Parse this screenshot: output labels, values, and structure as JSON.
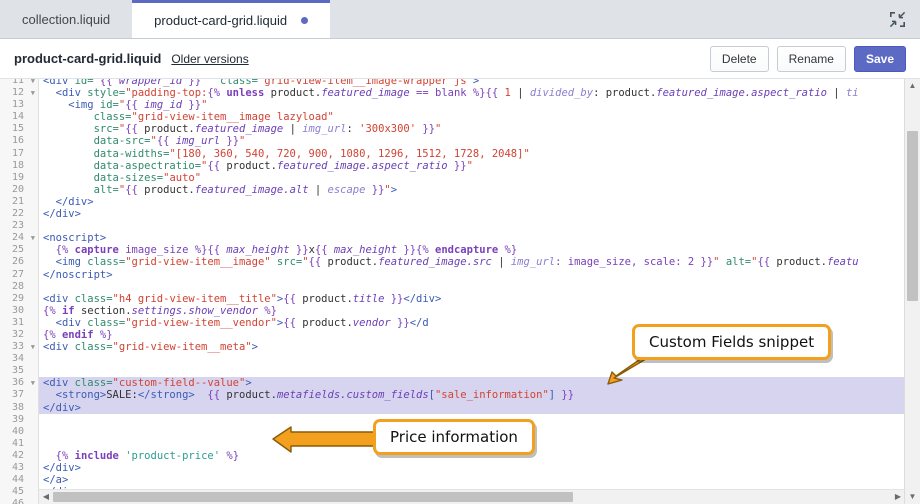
{
  "window": {
    "tabs": [
      {
        "label": "collection.liquid",
        "active": false,
        "modified": false
      },
      {
        "label": "product-card-grid.liquid",
        "active": true,
        "modified": true
      }
    ],
    "expand_icon": "collapse-arrows-icon"
  },
  "header": {
    "filename": "product-card-grid.liquid",
    "older_versions_label": "Older versions",
    "buttons": {
      "delete": "Delete",
      "rename": "Rename",
      "save": "Save"
    }
  },
  "colors": {
    "accent": "#5c6ac4",
    "callout_border": "#f2a01e",
    "highlight_row": "#d7d4f0",
    "tabbar_bg": "#dfe3e8"
  },
  "editor": {
    "first_line": 11,
    "last_line": 46,
    "highlighted_lines": [
      36,
      37,
      38
    ],
    "fold_markers": [
      11,
      12,
      24,
      33,
      36
    ],
    "lines": [
      {
        "n": 11,
        "tokens": [
          {
            "t": "<div ",
            "c": "t-tag"
          },
          {
            "t": "id=",
            "c": "t-attr"
          },
          {
            "t": "\"",
            "c": "t-str"
          },
          {
            "t": "{{ ",
            "c": "t-liq"
          },
          {
            "t": "wrapper_id",
            "c": "t-var"
          },
          {
            "t": " }}",
            "c": "t-liq"
          },
          {
            "t": "\"  ",
            "c": "t-str"
          },
          {
            "t": "class=",
            "c": "t-attr"
          },
          {
            "t": "\"grid-view-item__image-wrapper js\"",
            "c": "t-str"
          },
          {
            "t": ">",
            "c": "t-tag"
          }
        ]
      },
      {
        "n": 12,
        "tokens": [
          {
            "t": "  <div ",
            "c": "t-tag"
          },
          {
            "t": "style=",
            "c": "t-attr"
          },
          {
            "t": "\"padding-top:",
            "c": "t-str"
          },
          {
            "t": "{% ",
            "c": "t-liq"
          },
          {
            "t": "unless",
            "c": "t-kw"
          },
          {
            "t": " product.",
            "c": "t-plain"
          },
          {
            "t": "featured_image",
            "c": "t-var"
          },
          {
            "t": " == blank %}",
            "c": "t-liq"
          },
          {
            "t": "{{ ",
            "c": "t-liq"
          },
          {
            "t": "1",
            "c": "t-num"
          },
          {
            "t": " | ",
            "c": "t-plain"
          },
          {
            "t": "divided_by",
            "c": "t-flt"
          },
          {
            "t": ": product.",
            "c": "t-plain"
          },
          {
            "t": "featured_image.aspect_ratio",
            "c": "t-var"
          },
          {
            "t": " | ",
            "c": "t-plain"
          },
          {
            "t": "ti",
            "c": "t-flt"
          }
        ]
      },
      {
        "n": 13,
        "tokens": [
          {
            "t": "    <img ",
            "c": "t-tag"
          },
          {
            "t": "id=",
            "c": "t-attr"
          },
          {
            "t": "\"",
            "c": "t-str"
          },
          {
            "t": "{{ ",
            "c": "t-liq"
          },
          {
            "t": "img_id",
            "c": "t-var"
          },
          {
            "t": " }}",
            "c": "t-liq"
          },
          {
            "t": "\"",
            "c": "t-str"
          }
        ]
      },
      {
        "n": 14,
        "tokens": [
          {
            "t": "        ",
            "c": "t-plain"
          },
          {
            "t": "class=",
            "c": "t-attr"
          },
          {
            "t": "\"grid-view-item__image lazyload\"",
            "c": "t-str"
          }
        ]
      },
      {
        "n": 15,
        "tokens": [
          {
            "t": "        ",
            "c": "t-plain"
          },
          {
            "t": "src=",
            "c": "t-attr"
          },
          {
            "t": "\"",
            "c": "t-str"
          },
          {
            "t": "{{ ",
            "c": "t-liq"
          },
          {
            "t": "product.",
            "c": "t-plain"
          },
          {
            "t": "featured_image",
            "c": "t-var"
          },
          {
            "t": " | ",
            "c": "t-plain"
          },
          {
            "t": "img_url",
            "c": "t-flt"
          },
          {
            "t": ": ",
            "c": "t-plain"
          },
          {
            "t": "'300x300'",
            "c": "t-num"
          },
          {
            "t": " }}",
            "c": "t-liq"
          },
          {
            "t": "\"",
            "c": "t-str"
          }
        ]
      },
      {
        "n": 16,
        "tokens": [
          {
            "t": "        ",
            "c": "t-plain"
          },
          {
            "t": "data-src=",
            "c": "t-attr"
          },
          {
            "t": "\"",
            "c": "t-str"
          },
          {
            "t": "{{ ",
            "c": "t-liq"
          },
          {
            "t": "img_url",
            "c": "t-var"
          },
          {
            "t": " }}",
            "c": "t-liq"
          },
          {
            "t": "\"",
            "c": "t-str"
          }
        ]
      },
      {
        "n": 17,
        "tokens": [
          {
            "t": "        ",
            "c": "t-plain"
          },
          {
            "t": "data-widths=",
            "c": "t-attr"
          },
          {
            "t": "\"[180, 360, 540, 720, 900, 1080, 1296, 1512, 1728, 2048]\"",
            "c": "t-str"
          }
        ]
      },
      {
        "n": 18,
        "tokens": [
          {
            "t": "        ",
            "c": "t-plain"
          },
          {
            "t": "data-aspectratio=",
            "c": "t-attr"
          },
          {
            "t": "\"",
            "c": "t-str"
          },
          {
            "t": "{{ ",
            "c": "t-liq"
          },
          {
            "t": "product.",
            "c": "t-plain"
          },
          {
            "t": "featured_image.aspect_ratio",
            "c": "t-var"
          },
          {
            "t": " }}",
            "c": "t-liq"
          },
          {
            "t": "\"",
            "c": "t-str"
          }
        ]
      },
      {
        "n": 19,
        "tokens": [
          {
            "t": "        ",
            "c": "t-plain"
          },
          {
            "t": "data-sizes=",
            "c": "t-attr"
          },
          {
            "t": "\"auto\"",
            "c": "t-str"
          }
        ]
      },
      {
        "n": 20,
        "tokens": [
          {
            "t": "        ",
            "c": "t-plain"
          },
          {
            "t": "alt=",
            "c": "t-attr"
          },
          {
            "t": "\"",
            "c": "t-str"
          },
          {
            "t": "{{ ",
            "c": "t-liq"
          },
          {
            "t": "product.",
            "c": "t-plain"
          },
          {
            "t": "featured_image.alt",
            "c": "t-var"
          },
          {
            "t": " | ",
            "c": "t-plain"
          },
          {
            "t": "escape",
            "c": "t-flt"
          },
          {
            "t": " }}",
            "c": "t-liq"
          },
          {
            "t": "\"",
            "c": "t-str"
          },
          {
            "t": ">",
            "c": "t-tag"
          }
        ]
      },
      {
        "n": 21,
        "tokens": [
          {
            "t": "  </div>",
            "c": "t-tag"
          }
        ]
      },
      {
        "n": 22,
        "tokens": [
          {
            "t": "</div>",
            "c": "t-tag"
          }
        ]
      },
      {
        "n": 23,
        "tokens": []
      },
      {
        "n": 24,
        "tokens": [
          {
            "t": "<noscript>",
            "c": "t-tag"
          }
        ]
      },
      {
        "n": 25,
        "tokens": [
          {
            "t": "  ",
            "c": "t-plain"
          },
          {
            "t": "{% ",
            "c": "t-liq"
          },
          {
            "t": "capture",
            "c": "t-kw"
          },
          {
            "t": " image_size %}",
            "c": "t-liq"
          },
          {
            "t": "{{ ",
            "c": "t-liq"
          },
          {
            "t": "max_height",
            "c": "t-var"
          },
          {
            "t": " }}",
            "c": "t-liq"
          },
          {
            "t": "x",
            "c": "t-plain"
          },
          {
            "t": "{{ ",
            "c": "t-liq"
          },
          {
            "t": "max_height",
            "c": "t-var"
          },
          {
            "t": " }}",
            "c": "t-liq"
          },
          {
            "t": "{% ",
            "c": "t-liq"
          },
          {
            "t": "endcapture",
            "c": "t-kw"
          },
          {
            "t": " %}",
            "c": "t-liq"
          }
        ]
      },
      {
        "n": 26,
        "tokens": [
          {
            "t": "  <img ",
            "c": "t-tag"
          },
          {
            "t": "class=",
            "c": "t-attr"
          },
          {
            "t": "\"grid-view-item__image\"",
            "c": "t-str"
          },
          {
            "t": " src=",
            "c": "t-attr"
          },
          {
            "t": "\"",
            "c": "t-str"
          },
          {
            "t": "{{ ",
            "c": "t-liq"
          },
          {
            "t": "product.",
            "c": "t-plain"
          },
          {
            "t": "featured_image.src",
            "c": "t-var"
          },
          {
            "t": " | ",
            "c": "t-plain"
          },
          {
            "t": "img_url",
            "c": "t-flt"
          },
          {
            "t": ": image_size, scale: 2 }}",
            "c": "t-liq"
          },
          {
            "t": "\"",
            "c": "t-str"
          },
          {
            "t": " alt=",
            "c": "t-attr"
          },
          {
            "t": "\"",
            "c": "t-str"
          },
          {
            "t": "{{ ",
            "c": "t-liq"
          },
          {
            "t": "product.",
            "c": "t-plain"
          },
          {
            "t": "featu",
            "c": "t-var"
          }
        ]
      },
      {
        "n": 27,
        "tokens": [
          {
            "t": "</noscript>",
            "c": "t-tag"
          }
        ]
      },
      {
        "n": 28,
        "tokens": []
      },
      {
        "n": 29,
        "tokens": [
          {
            "t": "<div ",
            "c": "t-tag"
          },
          {
            "t": "class=",
            "c": "t-attr"
          },
          {
            "t": "\"h4 grid-view-item__title\"",
            "c": "t-str"
          },
          {
            "t": ">",
            "c": "t-tag"
          },
          {
            "t": "{{ ",
            "c": "t-liq"
          },
          {
            "t": "product.",
            "c": "t-plain"
          },
          {
            "t": "title",
            "c": "t-var"
          },
          {
            "t": " }}",
            "c": "t-liq"
          },
          {
            "t": "</div>",
            "c": "t-tag"
          }
        ]
      },
      {
        "n": 30,
        "tokens": [
          {
            "t": "{% ",
            "c": "t-liq"
          },
          {
            "t": "if",
            "c": "t-kw"
          },
          {
            "t": " section.",
            "c": "t-plain"
          },
          {
            "t": "settings.show_vendor",
            "c": "t-var"
          },
          {
            "t": " %}",
            "c": "t-liq"
          }
        ]
      },
      {
        "n": 31,
        "tokens": [
          {
            "t": "  <div ",
            "c": "t-tag"
          },
          {
            "t": "class=",
            "c": "t-attr"
          },
          {
            "t": "\"grid-view-item__vendor\"",
            "c": "t-str"
          },
          {
            "t": ">",
            "c": "t-tag"
          },
          {
            "t": "{{ ",
            "c": "t-liq"
          },
          {
            "t": "product.",
            "c": "t-plain"
          },
          {
            "t": "vendor",
            "c": "t-var"
          },
          {
            "t": " }}",
            "c": "t-liq"
          },
          {
            "t": "</d",
            "c": "t-tag"
          }
        ]
      },
      {
        "n": 32,
        "tokens": [
          {
            "t": "{% ",
            "c": "t-liq"
          },
          {
            "t": "endif",
            "c": "t-kw"
          },
          {
            "t": " %}",
            "c": "t-liq"
          }
        ]
      },
      {
        "n": 33,
        "tokens": [
          {
            "t": "<div ",
            "c": "t-tag"
          },
          {
            "t": "class=",
            "c": "t-attr"
          },
          {
            "t": "\"grid-view-item__meta\"",
            "c": "t-str"
          },
          {
            "t": ">",
            "c": "t-tag"
          }
        ]
      },
      {
        "n": 34,
        "tokens": []
      },
      {
        "n": 35,
        "tokens": []
      },
      {
        "n": 36,
        "tokens": [
          {
            "t": "<div ",
            "c": "t-tag"
          },
          {
            "t": "class=",
            "c": "t-attr"
          },
          {
            "t": "\"custom-field--value\"",
            "c": "t-str"
          },
          {
            "t": ">",
            "c": "t-tag"
          }
        ]
      },
      {
        "n": 37,
        "tokens": [
          {
            "t": "  <strong>",
            "c": "t-tag"
          },
          {
            "t": "SALE:",
            "c": "t-plain"
          },
          {
            "t": "</strong>",
            "c": "t-tag"
          },
          {
            "t": "  ",
            "c": "t-plain"
          },
          {
            "t": "{{ ",
            "c": "t-liq"
          },
          {
            "t": "product.",
            "c": "t-plain"
          },
          {
            "t": "metafields.custom_fields",
            "c": "t-var"
          },
          {
            "t": "[",
            "c": "t-tag"
          },
          {
            "t": "\"sale_information\"",
            "c": "t-str"
          },
          {
            "t": "]",
            "c": "t-tag"
          },
          {
            "t": " }}",
            "c": "t-liq"
          }
        ]
      },
      {
        "n": 38,
        "tokens": [
          {
            "t": "</div>",
            "c": "t-tag"
          }
        ]
      },
      {
        "n": 39,
        "tokens": []
      },
      {
        "n": 40,
        "tokens": []
      },
      {
        "n": 41,
        "tokens": []
      },
      {
        "n": 42,
        "tokens": [
          {
            "t": "  ",
            "c": "t-plain"
          },
          {
            "t": "{% ",
            "c": "t-liq"
          },
          {
            "t": "include",
            "c": "t-kw"
          },
          {
            "t": " ",
            "c": "t-plain"
          },
          {
            "t": "'product-price'",
            "c": "t-sq"
          },
          {
            "t": " %}",
            "c": "t-liq"
          }
        ]
      },
      {
        "n": 43,
        "tokens": [
          {
            "t": "</div>",
            "c": "t-tag"
          }
        ]
      },
      {
        "n": 44,
        "tokens": [
          {
            "t": "</a>",
            "c": "t-tag"
          }
        ]
      },
      {
        "n": 45,
        "tokens": [
          {
            "t": "</div>",
            "c": "t-tag"
          }
        ]
      },
      {
        "n": 46,
        "tokens": []
      }
    ]
  },
  "annotations": [
    {
      "id": "custom-fields-callout",
      "label": "Custom Fields snippet"
    },
    {
      "id": "price-information-callout",
      "label": "Price information"
    }
  ]
}
